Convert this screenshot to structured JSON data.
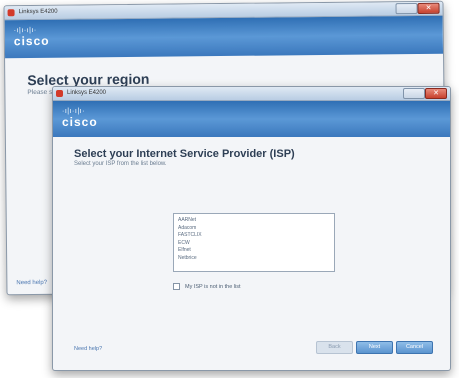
{
  "back_window": {
    "title": "Linksys E4200",
    "brand_bars": "·ı|ı·ı|ı·",
    "brand": "cisco",
    "heading": "Select your region",
    "subheading": "Please select your region from the list below.",
    "help_link": "Need help?"
  },
  "front_window": {
    "title": "Linksys E4200",
    "brand_bars": "·ı|ı·ı|ı·",
    "brand": "cisco",
    "heading": "Select your Internet Service Provider (ISP)",
    "subheading": "Select your ISP from the list below.",
    "isp_list": [
      "AARNet",
      "Adacom",
      "FASTCLIX",
      "ECW",
      "Elfnet",
      "Netbrice"
    ],
    "not_listed_label": "My ISP is not in the list",
    "help_link": "Need help?",
    "buttons": {
      "back": "Back",
      "next": "Next",
      "cancel": "Cancel"
    }
  },
  "colors": {
    "header_blue": "#3b78bd",
    "button_blue": "#5b94cf",
    "close_red": "#c7412e"
  },
  "icons": {
    "app": "app-icon",
    "close": "close-icon"
  }
}
